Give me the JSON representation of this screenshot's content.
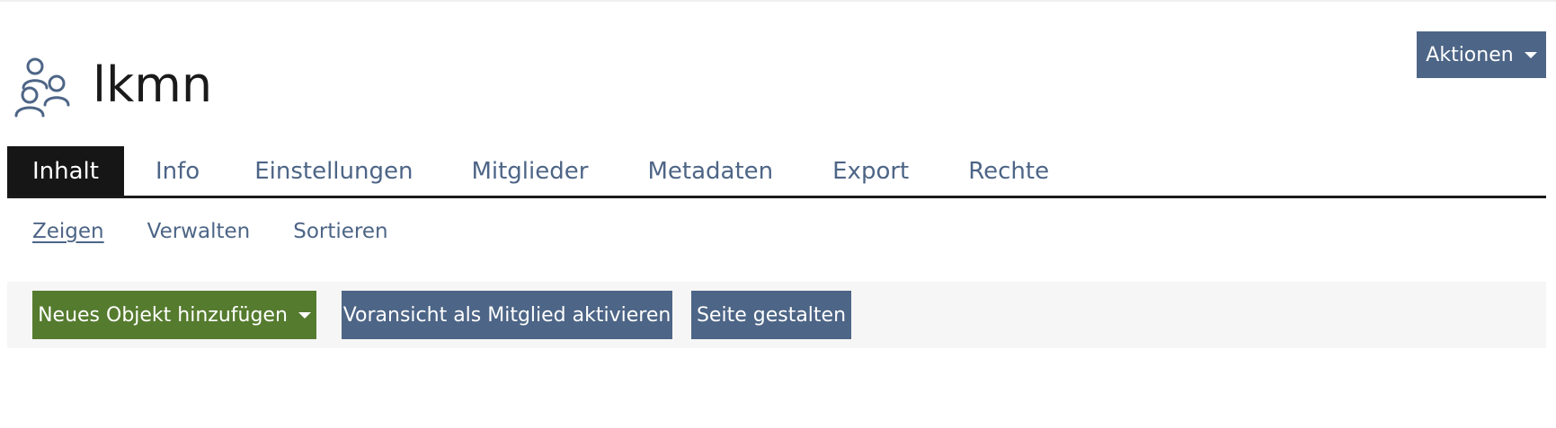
{
  "header": {
    "title": "lkmn",
    "icon": "group-users-icon",
    "actions_label": "Aktionen"
  },
  "tabs": [
    {
      "label": "Inhalt",
      "active": true
    },
    {
      "label": "Info"
    },
    {
      "label": "Einstellungen"
    },
    {
      "label": "Mitglieder"
    },
    {
      "label": "Metadaten"
    },
    {
      "label": "Export"
    },
    {
      "label": "Rechte"
    }
  ],
  "subtabs": [
    {
      "label": "Zeigen",
      "active": true
    },
    {
      "label": "Verwalten"
    },
    {
      "label": "Sortieren"
    }
  ],
  "toolbar": {
    "add_object_label": "Neues Objekt hinzufügen",
    "preview_label": "Voransicht als Mitglied aktivieren",
    "design_label": "Seite gestalten"
  },
  "colors": {
    "primary": "#4d6586",
    "success": "#557b2e",
    "active_tab": "#161616",
    "toolbar_bg": "#f6f6f6"
  }
}
